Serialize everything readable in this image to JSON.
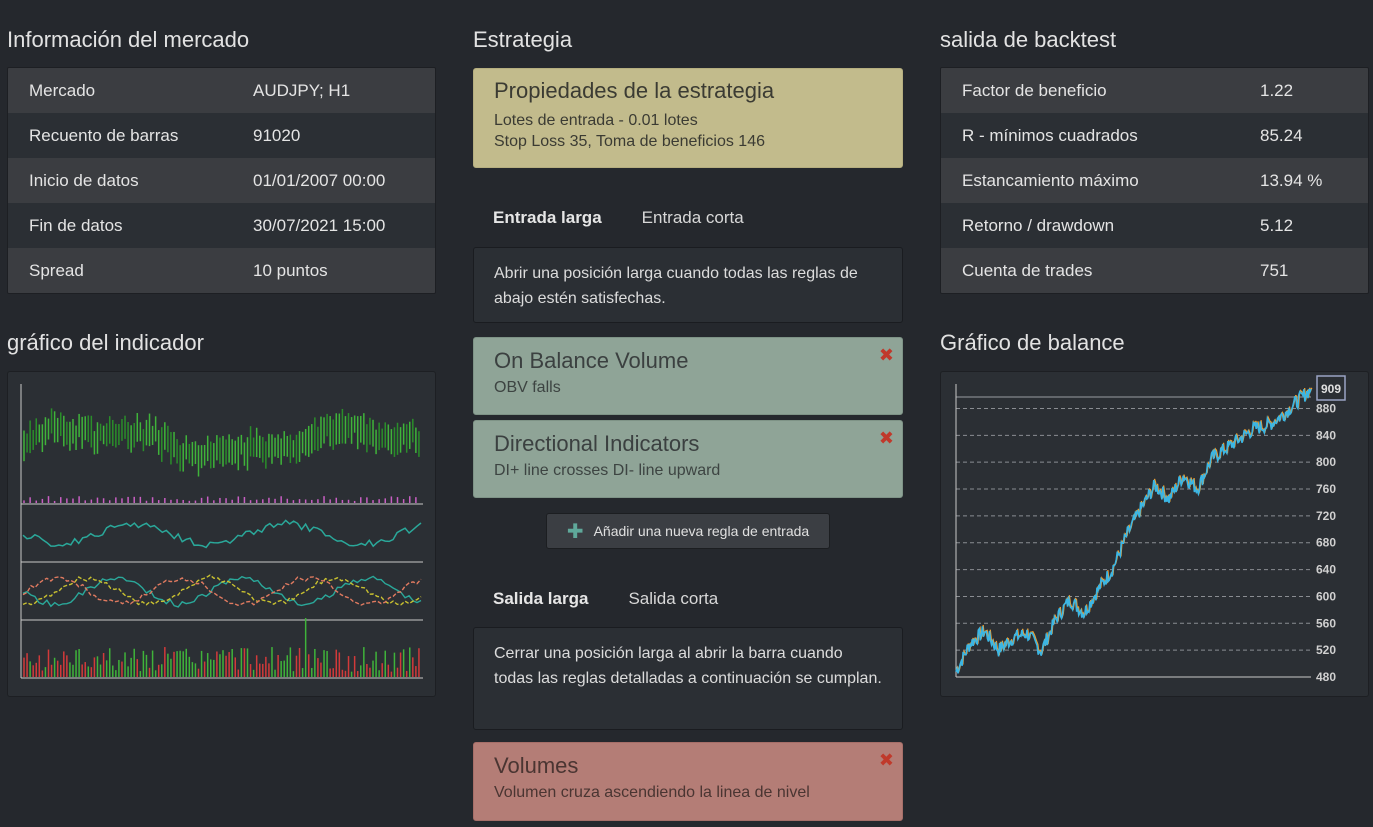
{
  "market": {
    "title": "Información del mercado",
    "rows": [
      {
        "k": "Mercado",
        "v": "AUDJPY; H1"
      },
      {
        "k": "Recuento de barras",
        "v": "91020"
      },
      {
        "k": "Inicio de datos",
        "v": "01/01/2007 00:00"
      },
      {
        "k": "Fin de datos",
        "v": "30/07/2021 15:00"
      },
      {
        "k": "Spread",
        "v": "10 puntos"
      }
    ]
  },
  "indicator_chart": {
    "title": "gráfico del indicador"
  },
  "strategy": {
    "title": "Estrategia",
    "props_title": "Propiedades de la estrategia",
    "props_line1": "Lotes de entrada - 0.01 lotes",
    "props_line2": "Stop Loss 35, Toma de beneficios 146",
    "entry_tabs": [
      "Entrada larga",
      "Entrada corta"
    ],
    "entry_desc": "Abrir una posición larga cuando todas las reglas de abajo estén satisfechas.",
    "entry_rules": [
      {
        "title": "On Balance Volume",
        "sub": "OBV falls"
      },
      {
        "title": "Directional Indicators",
        "sub": "DI+ line crosses DI- line upward"
      }
    ],
    "add_rule_label": "Añadir una nueva regla de entrada",
    "exit_tabs": [
      "Salida larga",
      "Salida corta"
    ],
    "exit_desc": "Cerrar una posición larga al abrir la barra cuando todas las reglas detalladas a continuación se cumplan.",
    "exit_rules": [
      {
        "title": "Volumes",
        "sub": "Volumen cruza ascendiendo la linea de nivel"
      }
    ],
    "close_glyph": "✖",
    "plus_glyph": "✚"
  },
  "backtest": {
    "title": "salida de backtest",
    "rows": [
      {
        "k": "Factor de beneficio",
        "v": "1.22"
      },
      {
        "k": "R - mínimos cuadrados",
        "v": "85.24"
      },
      {
        "k": "Estancamiento máximo",
        "v": "13.94 %"
      },
      {
        "k": "Retorno / drawdown",
        "v": "5.12"
      },
      {
        "k": "Cuenta de trades",
        "v": "751"
      }
    ]
  },
  "balance_chart": {
    "title": "Gráfico de balance",
    "current_label": "909"
  },
  "chart_data": [
    {
      "type": "line",
      "name": "balance",
      "y_ticks": [
        480,
        520,
        560,
        600,
        640,
        680,
        720,
        760,
        800,
        840,
        880
      ],
      "ylim": [
        480,
        909
      ],
      "grid": true,
      "x": [
        0,
        4,
        8,
        12,
        16,
        20,
        24,
        28,
        32,
        36,
        40,
        44,
        48,
        52,
        56,
        60,
        64,
        68,
        72,
        76,
        80,
        84,
        88,
        92,
        96,
        100
      ],
      "values": [
        488,
        530,
        548,
        520,
        538,
        545,
        518,
        565,
        595,
        575,
        610,
        640,
        690,
        730,
        765,
        745,
        780,
        760,
        805,
        820,
        835,
        850,
        855,
        870,
        890,
        909
      ]
    },
    {
      "type": "line",
      "name": "indicator",
      "panels": [
        "price",
        "oscillator",
        "lines",
        "volume"
      ]
    }
  ]
}
